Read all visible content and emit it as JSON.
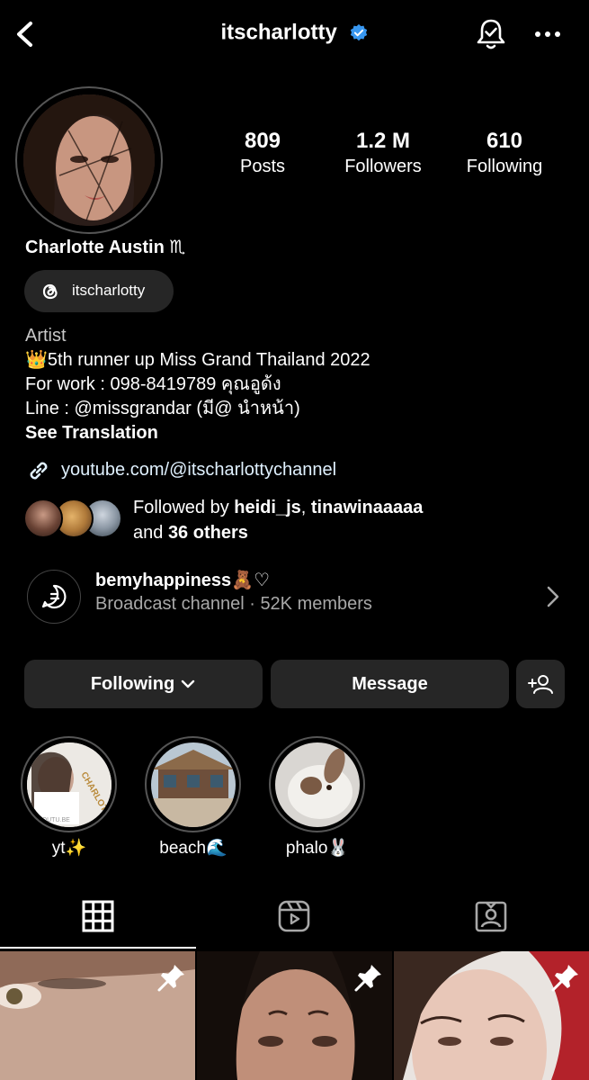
{
  "header": {
    "username": "itscharlotty",
    "verified": true
  },
  "profile": {
    "stats": [
      {
        "value": "809",
        "label": "Posts"
      },
      {
        "value": "1.2 M",
        "label": "Followers"
      },
      {
        "value": "610",
        "label": "Following"
      }
    ],
    "display_name": "Charlotte Austin ♏︎",
    "threads_handle": "itscharlotty",
    "bio": {
      "category": "Artist",
      "line1": "👑5th runner up Miss Grand Thailand 2022",
      "line2": "For work : 098-8419789 คุณอูด้ง",
      "line3": "Line : @missgrandar (มี@ นำหน้า)",
      "see_translation": "See Translation"
    },
    "link": "youtube.com/@itscharlottychannel",
    "followed_by": {
      "prefix": "Followed by ",
      "user1": "heidi_js",
      "sep": ", ",
      "user2": "tinawinaaaaa",
      "and": "and ",
      "others": "36 others"
    }
  },
  "broadcast": {
    "title": "bemyhappiness🧸♡",
    "subtitle": "Broadcast channel · 52K members"
  },
  "actions": {
    "following": "Following",
    "message": "Message"
  },
  "highlights": [
    {
      "label": "yt✨"
    },
    {
      "label": "beach🌊"
    },
    {
      "label": "phalo🐰"
    }
  ],
  "highlight_texts": {
    "yt_cover_text": "CHARLOTTY",
    "yt_cover_small": "YOUTU.BE"
  },
  "colors": {
    "background": "#000000",
    "button": "#262626",
    "verified": "#3897f0",
    "link": "#e0f1ff"
  }
}
